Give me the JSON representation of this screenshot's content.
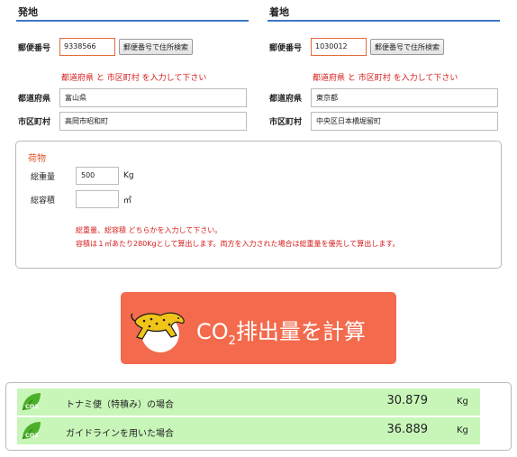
{
  "origin": {
    "title": "発地",
    "zip_label": "郵便番号",
    "zip_value": "9338566",
    "zip_button": "郵便番号で住所検索",
    "warning": "都道府県 と 市区町村 を入力して下さい",
    "pref_label": "都道府県",
    "pref_value": "富山県",
    "city_label": "市区町村",
    "city_value": "高岡市昭和町"
  },
  "destination": {
    "title": "着地",
    "zip_label": "郵便番号",
    "zip_value": "1030012",
    "zip_button": "郵便番号で住所検索",
    "warning": "都道府県 と 市区町村 を入力して下さい",
    "pref_label": "都道府県",
    "pref_value": "東京都",
    "city_label": "市区町村",
    "city_value": "中央区日本橋堀留町"
  },
  "cargo": {
    "title": "荷物",
    "weight_label": "総重量",
    "weight_value": "500",
    "weight_unit": "Kg",
    "volume_label": "総容積",
    "volume_value": "",
    "volume_unit": "㎥",
    "note_line1": "総重量、総容積 どちらかを入力して下さい。",
    "note_line2": "容積は１㎥あたり280Kgとして算出します。両方を入力された場合は総重量を優先して算出します。"
  },
  "calculate_button": {
    "co": "CO",
    "sub": "2",
    "rest": "排出量を計算",
    "color": "#f36a4d"
  },
  "results": [
    {
      "icon": "co2-leaf-icon",
      "label": "トナミ便（特積み）の場合",
      "value": "30.879",
      "unit": "Kg"
    },
    {
      "icon": "co2-leaf-icon",
      "label": "ガイドラインを用いた場合",
      "value": "36.889",
      "unit": "Kg"
    }
  ],
  "colors": {
    "accent_blue": "#3b78c2",
    "warning_red": "#d61b1b",
    "result_green": "#c8f6b9",
    "input_orange": "#e36a3c"
  }
}
